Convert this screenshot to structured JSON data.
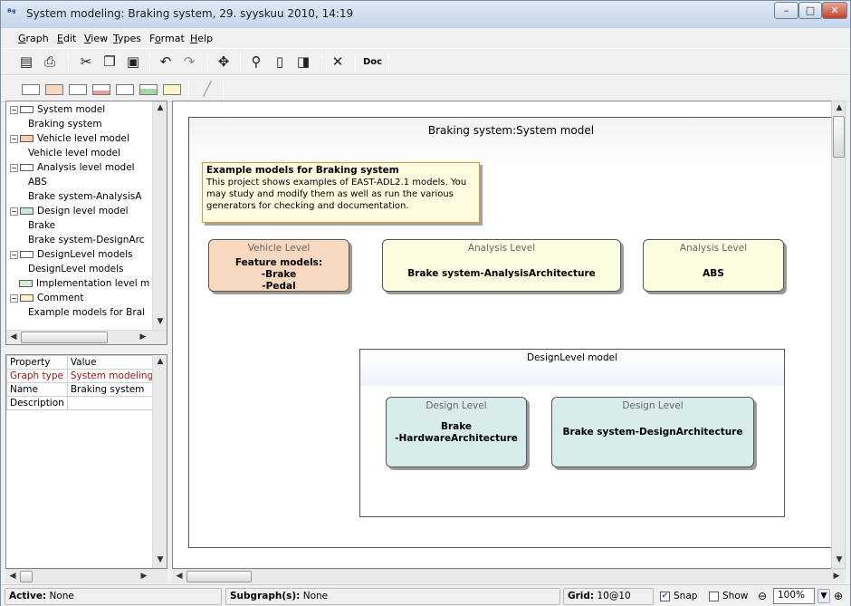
{
  "window": {
    "title": "System modeling: Braking system, 29. syyskuu 2010, 14:19",
    "app_icon": "graph-app-icon",
    "controls": [
      "minimize",
      "maximize",
      "close"
    ]
  },
  "menu": [
    {
      "pre": "",
      "ul": "G",
      "post": "raph"
    },
    {
      "pre": "",
      "ul": "E",
      "post": "dit"
    },
    {
      "pre": "",
      "ul": "V",
      "post": "iew"
    },
    {
      "pre": "",
      "ul": "T",
      "post": "ypes"
    },
    {
      "pre": "F",
      "ul": "o",
      "post": "rmat"
    },
    {
      "pre": "",
      "ul": "H",
      "post": "elp"
    }
  ],
  "toolbar1": {
    "doc_label": "Doc",
    "icons": [
      "properties-icon",
      "print-icon",
      "cut-icon",
      "copy-icon",
      "paste-icon",
      "undo-icon",
      "redo-icon",
      "select-icon",
      "zoom-icon",
      "page-icon",
      "page-setup-icon",
      "delete-icon"
    ]
  },
  "toolbar2": {
    "shapes": [
      "graph-object",
      "vehicle-level",
      "analysis-level",
      "design-level",
      "implementation-level",
      "design-level-model",
      "comment",
      "relationship-line"
    ]
  },
  "tree": {
    "items": [
      {
        "label": "System model",
        "expandable": true,
        "icon_color": "#ffffff"
      },
      {
        "label": "Braking system",
        "expandable": false
      },
      {
        "label": "Vehicle level model",
        "expandable": true,
        "icon_color": "#f4cdb0"
      },
      {
        "label": "Vehicle level model",
        "expandable": false
      },
      {
        "label": "Analysis level model",
        "expandable": true,
        "icon_color": "#ffffff"
      },
      {
        "label": "ABS",
        "expandable": false
      },
      {
        "label": "Brake system-AnalysisA",
        "expandable": false
      },
      {
        "label": "Design level model",
        "expandable": true,
        "icon_color": "#cfe6e6"
      },
      {
        "label": "Brake",
        "expandable": false
      },
      {
        "label": "Brake system-DesignArc",
        "expandable": false
      },
      {
        "label": "DesignLevel models",
        "expandable": true,
        "icon_color": "#ffffff"
      },
      {
        "label": "DesignLevel models",
        "expandable": false
      },
      {
        "label": "Implementation level m",
        "expandable": false,
        "icon_color": "#d4eed4"
      },
      {
        "label": "Comment",
        "expandable": true,
        "icon_color": "#fff4c8"
      },
      {
        "label": "Example models for Bral",
        "expandable": false
      }
    ]
  },
  "properties": {
    "headers": [
      "Property",
      "Value"
    ],
    "rows": [
      {
        "property": "Graph type",
        "value": "System modeling"
      },
      {
        "property": "Name",
        "value": "Braking system"
      },
      {
        "property": "Description",
        "value": ""
      }
    ],
    "highlight_color": "#a31515"
  },
  "diagram": {
    "title": "Braking system:System model",
    "note": {
      "heading": "Example models for Braking system",
      "body": "This project shows examples of EAST-ADL2.1 models. You may study and modify them as well as run the various generators for checking and documentation."
    },
    "blocks": [
      {
        "kind": "Vehicle Level",
        "name": "Feature models:\n-Brake\n-Pedal",
        "color": "#f8d8bf"
      },
      {
        "kind": "Analysis Level",
        "name": "Brake system-AnalysisArchitecture",
        "color": "#fdfde2"
      },
      {
        "kind": "Analysis Level",
        "name": "ABS",
        "color": "#fdfde2"
      }
    ],
    "design_model": {
      "title": "DesignLevel model",
      "blocks": [
        {
          "kind": "Design Level",
          "name": "Brake\n-HardwareArchitecture",
          "color": "#d8ecec"
        },
        {
          "kind": "Design Level",
          "name": "Brake system-DesignArchitecture",
          "color": "#d8ecec"
        }
      ]
    }
  },
  "status": {
    "active_label": "Active:",
    "active_value": "None",
    "subgraph_label": "Subgraph(s):",
    "subgraph_value": "None",
    "grid_label": "Grid:",
    "grid_value": "10@10",
    "snap_label": "Snap",
    "snap_checked": true,
    "show_label": "Show",
    "show_checked": false,
    "zoom": "100%"
  }
}
